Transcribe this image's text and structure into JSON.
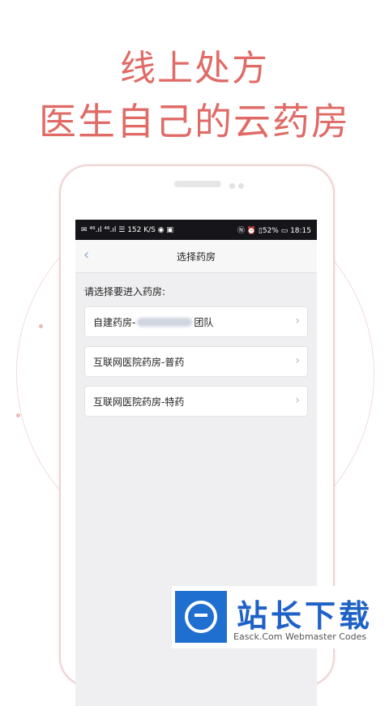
{
  "headline": {
    "line1": "线上处方",
    "line2": "医生自己的云药房"
  },
  "status_bar": {
    "left_text": "✉ ⁴⁶.ıl ⁴⁶.ıl ☰ 152 K/S ◉ ▣",
    "right_text": "Ⓝ ⏰ ▯52% ▭ 18:15"
  },
  "nav": {
    "back_icon": "chevron-left-icon",
    "title": "选择药房"
  },
  "prompt": "请选择要进入药房:",
  "pharmacies": [
    {
      "prefix": "自建药房-",
      "suffix": "团队",
      "has_blur": true
    },
    {
      "prefix": "互联网医院药房-普药",
      "suffix": "",
      "has_blur": false
    },
    {
      "prefix": "互联网医院药房-特药",
      "suffix": "",
      "has_blur": false
    }
  ],
  "chevron": "›",
  "watermark": {
    "title": "站长下载",
    "subtitle": "Easck.Com Webmaster Codes"
  },
  "colors": {
    "headline": "#e06b66",
    "statusbar": "#16161a",
    "watermark_blue": "#1f6fd0"
  }
}
